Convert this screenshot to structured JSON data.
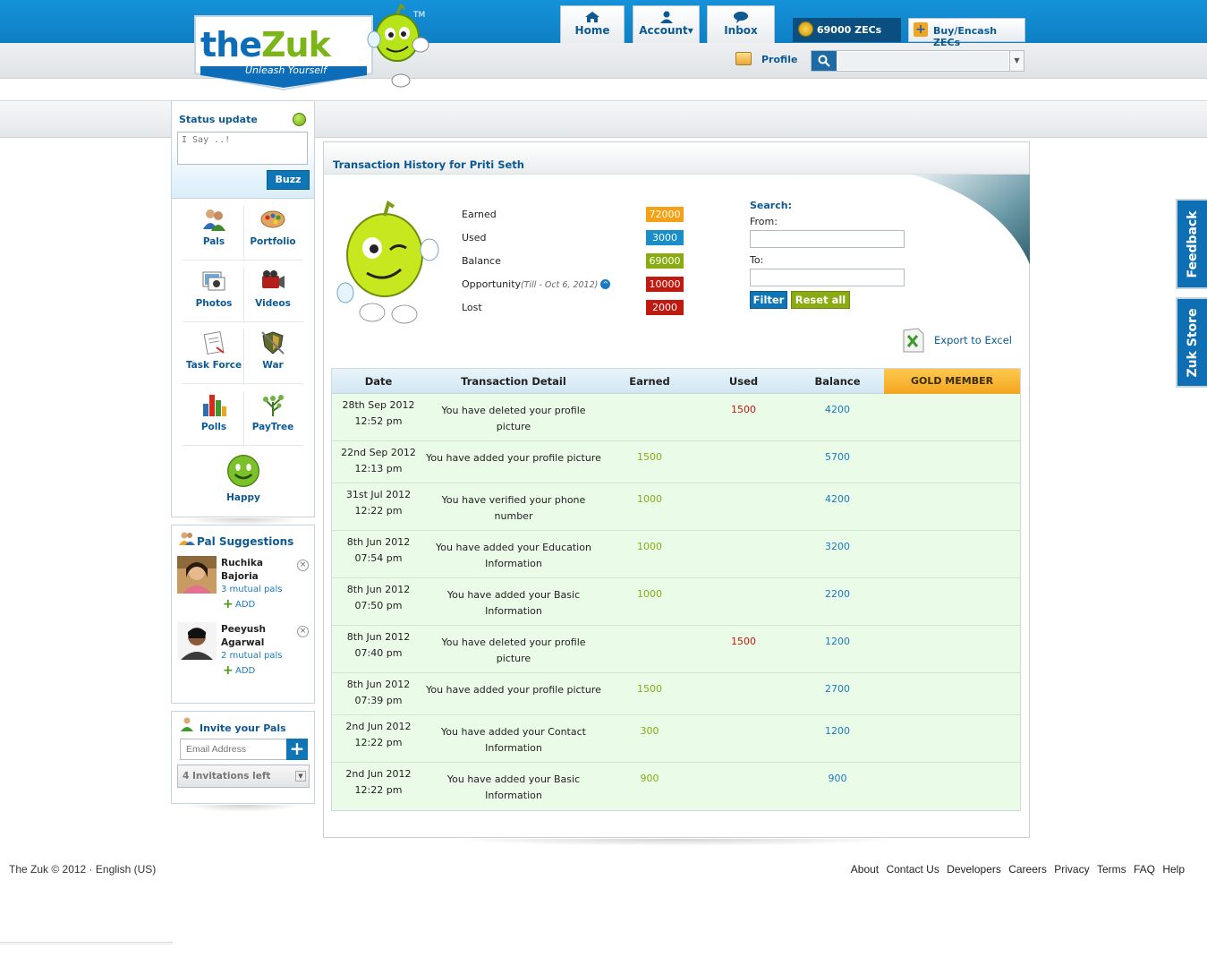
{
  "header": {
    "logo_text_the": "the",
    "logo_text_zuk": "Zuk",
    "logo_tagline": "Unleash Yourself",
    "logo_tm": "TM",
    "nav": [
      {
        "label": "Home",
        "icon": "home-icon"
      },
      {
        "label": "Account▾",
        "icon": "account-icon"
      },
      {
        "label": "Inbox",
        "icon": "inbox-icon"
      }
    ],
    "zecs": "69000 ZECs",
    "buy_label": "Buy/Encash ZECs",
    "profile_label": "Profile",
    "search_value": ""
  },
  "sidebar": {
    "status_title": "Status update",
    "status_placeholder": "I Say ..!",
    "buzz_label": "Buzz",
    "apps": [
      {
        "label": "Pals",
        "icon": "pals-icon"
      },
      {
        "label": "Portfolio",
        "icon": "portfolio-icon"
      },
      {
        "label": "Photos",
        "icon": "photos-icon"
      },
      {
        "label": "Videos",
        "icon": "videos-icon"
      },
      {
        "label": "Task Force",
        "icon": "task-force-icon"
      },
      {
        "label": "War",
        "icon": "war-icon"
      },
      {
        "label": "Polls",
        "icon": "polls-icon"
      },
      {
        "label": "PayTree",
        "icon": "paytree-icon"
      },
      {
        "label": "Happy",
        "icon": "happy-icon"
      }
    ],
    "pal_suggestions_title": "Pal Suggestions",
    "pal_suggestions": [
      {
        "name": "Ruchika Bajoria",
        "mutual": "3 mutual pals",
        "add": "ADD"
      },
      {
        "name": "Peeyush Agarwal",
        "mutual": "2 mutual pals",
        "add": "ADD"
      }
    ],
    "invite_title": "Invite your Pals",
    "invite_placeholder": "Email Address",
    "invitations_left": "4 Invitations left"
  },
  "main": {
    "title": "Transaction History for Priti Seth",
    "stats": [
      {
        "label": "Earned",
        "value": "72000",
        "color": "#f4a116"
      },
      {
        "label": "Used",
        "value": "3000",
        "color": "#1a8ec9"
      },
      {
        "label": "Balance",
        "value": "69000",
        "color": "#8aab12"
      },
      {
        "label": "Opportunity",
        "note": "(Till - Oct 6, 2012)",
        "value": "10000",
        "color": "#c0190f"
      },
      {
        "label": "Lost",
        "value": "2000",
        "color": "#c0190f"
      }
    ],
    "search": {
      "heading": "Search:",
      "from_label": "From:",
      "to_label": "To:",
      "from_value": "",
      "to_value": "",
      "filter_label": "Filter",
      "reset_label": "Reset all"
    },
    "export_label": "Export to Excel",
    "table": {
      "headers": [
        "Date",
        "Transaction Detail",
        "Earned",
        "Used",
        "Balance"
      ],
      "membership": "GOLD MEMBER",
      "rows": [
        {
          "date1": "28th Sep 2012",
          "date2": "12:52 pm",
          "d1": "You have deleted your profile",
          "d2": "picture",
          "earned": "",
          "used": "1500",
          "balance": "4200"
        },
        {
          "date1": "22nd Sep 2012",
          "date2": "12:13 pm",
          "d1": "You have added your profile picture",
          "d2": "",
          "earned": "1500",
          "used": "",
          "balance": "5700"
        },
        {
          "date1": "31st Jul 2012",
          "date2": "12:22 pm",
          "d1": "You have verified your phone",
          "d2": "number",
          "earned": "1000",
          "used": "",
          "balance": "4200"
        },
        {
          "date1": "8th Jun 2012",
          "date2": "07:54 pm",
          "d1": "You have added your Education",
          "d2": "Information",
          "earned": "1000",
          "used": "",
          "balance": "3200"
        },
        {
          "date1": "8th Jun 2012",
          "date2": "07:50 pm",
          "d1": "You have added your Basic",
          "d2": "Information",
          "earned": "1000",
          "used": "",
          "balance": "2200"
        },
        {
          "date1": "8th Jun 2012",
          "date2": "07:40 pm",
          "d1": "You have deleted your profile",
          "d2": "picture",
          "earned": "",
          "used": "1500",
          "balance": "1200"
        },
        {
          "date1": "8th Jun 2012",
          "date2": "07:39 pm",
          "d1": "You have added your profile picture",
          "d2": "",
          "earned": "1500",
          "used": "",
          "balance": "2700"
        },
        {
          "date1": "2nd Jun 2012",
          "date2": "12:22 pm",
          "d1": "You have added your Contact",
          "d2": "Information",
          "earned": "300",
          "used": "",
          "balance": "1200"
        },
        {
          "date1": "2nd Jun 2012",
          "date2": "12:22 pm",
          "d1": "You have added your Basic",
          "d2": "Information",
          "earned": "900",
          "used": "",
          "balance": "900"
        }
      ]
    }
  },
  "side_tabs": {
    "feedback": "Feedback",
    "store": "Zuk Store"
  },
  "footer": {
    "copyright": "The Zuk © 2012 · English (US)",
    "links": [
      "About",
      "Contact Us",
      "Developers",
      "Careers",
      "Privacy",
      "Terms",
      "FAQ",
      "Help"
    ]
  }
}
